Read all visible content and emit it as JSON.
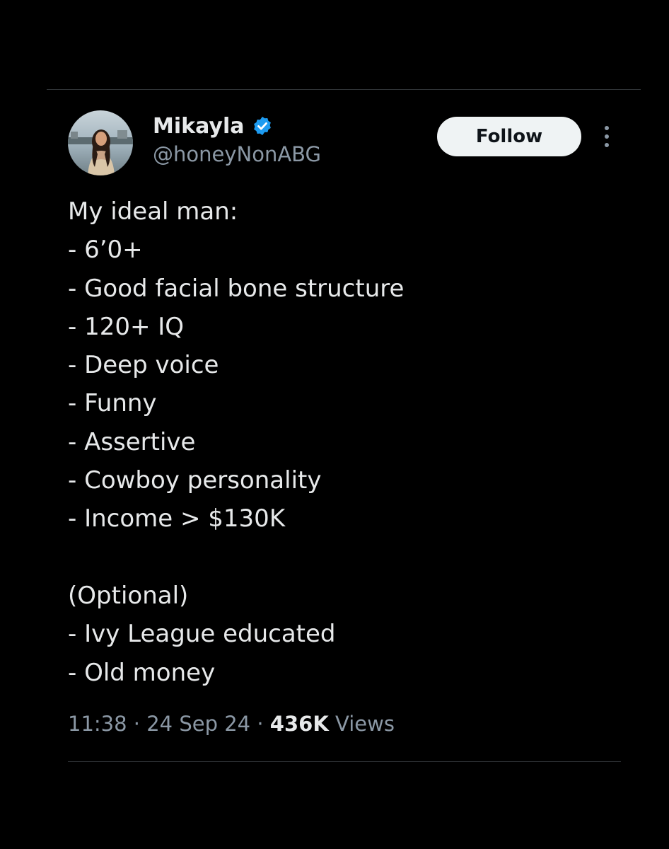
{
  "author": {
    "name": "Mikayla",
    "handle": "@honeyNonABG",
    "verified_color": "#1d9bf0"
  },
  "follow_label": "Follow",
  "icons": {
    "verified": "verified-badge-icon",
    "more": "more-options-icon"
  },
  "tweet": {
    "lines": [
      "My ideal man:",
      "- 6’0+",
      "- Good facial bone structure",
      "- 120+ IQ",
      "- Deep voice",
      "- Funny",
      "- Assertive",
      "- Cowboy personality",
      "- Income > $130K",
      "",
      "(Optional)",
      "- Ivy League educated",
      "- Old money"
    ]
  },
  "meta": {
    "time": "11:38",
    "date": "24 Sep 24",
    "views_count": "436K",
    "views_label": "Views",
    "separator": "·"
  },
  "colors": {
    "background": "#000000",
    "text": "#e7e9ea",
    "secondary_text": "#8b98a5",
    "divider": "#2f3336",
    "follow_bg": "#eff3f4",
    "follow_text": "#0f1419"
  }
}
